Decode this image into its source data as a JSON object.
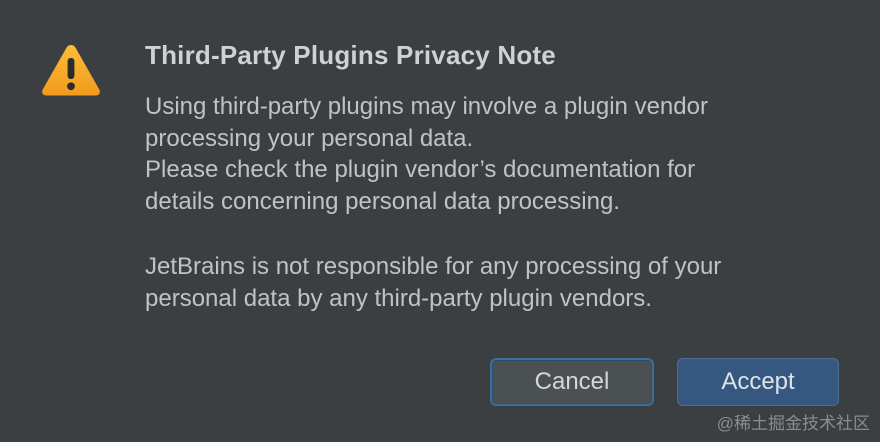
{
  "dialog": {
    "title": "Third-Party Plugins Privacy Note",
    "icon": "warning-icon",
    "message": {
      "line1": "Using third-party plugins may involve a plugin vendor",
      "line2": "processing your personal data.",
      "line3": "Please check the plugin vendor’s documentation for",
      "line4": "details concerning personal data processing.",
      "line5": "JetBrains is not responsible for any processing of your",
      "line6": "personal data by any third-party plugin vendors."
    },
    "buttons": {
      "cancel_label": "Cancel",
      "accept_label": "Accept"
    }
  },
  "watermark": "@稀土掘金技术社区",
  "colors": {
    "background": "#3c3f41",
    "title_text": "#cfd2d4",
    "body_text": "#c0c3c5",
    "accept_button": "#365880",
    "cancel_button": "#4b5053",
    "focus_border": "#3d6e9c",
    "warning_fill": "#f5a623"
  }
}
